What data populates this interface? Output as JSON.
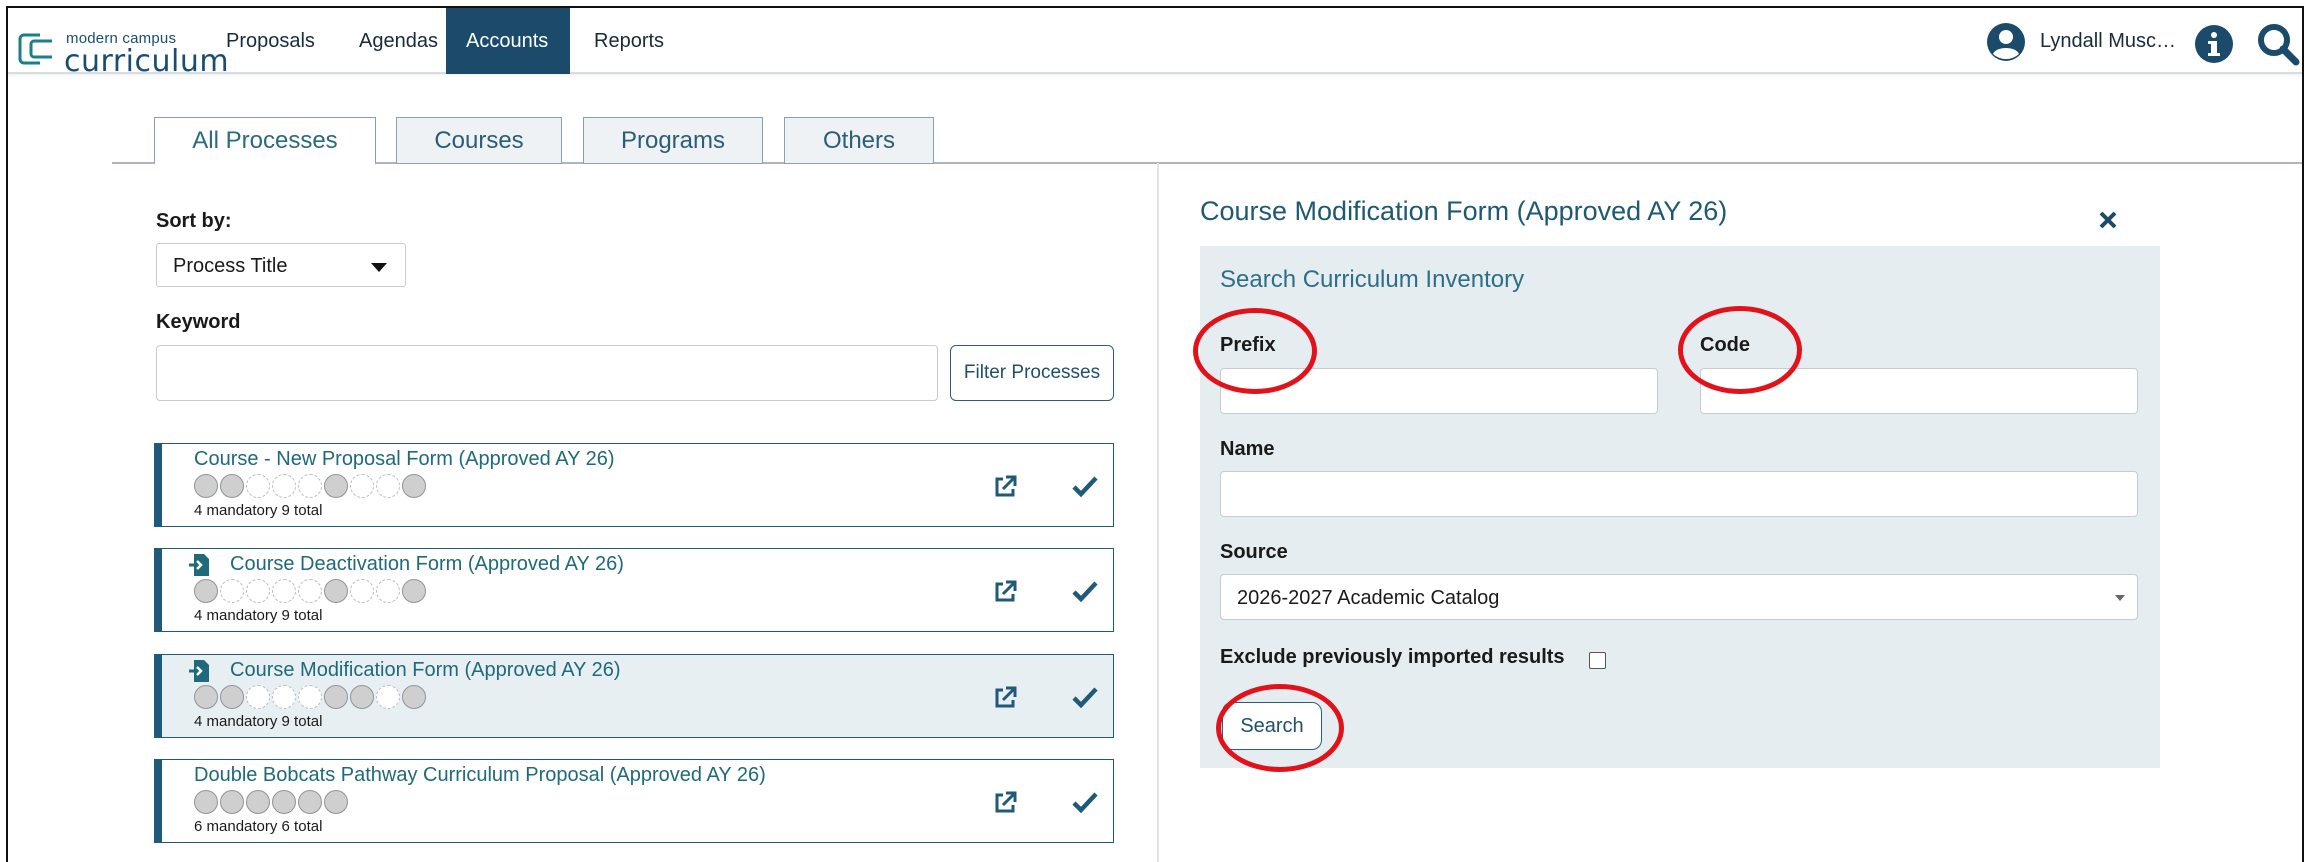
{
  "app": {
    "logo_small": "modern campus",
    "logo_big": "curriculum"
  },
  "nav": {
    "items": [
      {
        "label": "Proposals",
        "active": false
      },
      {
        "label": "Agendas",
        "active": false
      },
      {
        "label": "Accounts",
        "active": true
      },
      {
        "label": "Reports",
        "active": false
      }
    ],
    "user_name": "Lyndall Musc…"
  },
  "tabs": [
    {
      "label": "All Processes",
      "active": true
    },
    {
      "label": "Courses",
      "active": false
    },
    {
      "label": "Programs",
      "active": false
    },
    {
      "label": "Others",
      "active": false
    }
  ],
  "filters": {
    "sort_label": "Sort by:",
    "sort_value": "Process Title",
    "keyword_label": "Keyword",
    "keyword_value": "",
    "filter_button": "Filter Processes"
  },
  "processes": [
    {
      "title": "Course - New Proposal Form (Approved AY 26)",
      "has_doc_icon": false,
      "steps": [
        "f",
        "f",
        "e",
        "e",
        "e",
        "f",
        "e",
        "e",
        "f"
      ],
      "count": "4 mandatory 9 total",
      "selected": false
    },
    {
      "title": "Course Deactivation Form (Approved AY 26)",
      "has_doc_icon": true,
      "steps": [
        "f",
        "e",
        "e",
        "e",
        "e",
        "f",
        "e",
        "e",
        "f"
      ],
      "count": "4 mandatory 9 total",
      "selected": false
    },
    {
      "title": "Course Modification Form (Approved AY 26)",
      "has_doc_icon": true,
      "steps": [
        "f",
        "f",
        "e",
        "e",
        "e",
        "f",
        "f",
        "e",
        "f"
      ],
      "count": "4 mandatory 9 total",
      "selected": true
    },
    {
      "title": "Double Bobcats Pathway Curriculum Proposal (Approved AY 26)",
      "has_doc_icon": false,
      "steps": [
        "f",
        "f",
        "f",
        "f",
        "f",
        "f"
      ],
      "count": "6 mandatory 6 total",
      "selected": false
    }
  ],
  "detail": {
    "title": "Course Modification Form (Approved AY 26)",
    "search_title": "Search Curriculum Inventory",
    "prefix_label": "Prefix",
    "prefix_value": "",
    "code_label": "Code",
    "code_value": "",
    "name_label": "Name",
    "name_value": "",
    "source_label": "Source",
    "source_value": "2026-2027 Academic Catalog",
    "exclude_label": "Exclude previously imported results",
    "exclude_checked": false,
    "search_button": "Search"
  },
  "colors": {
    "brand": "#1b4a6b",
    "link": "#1f6a7a",
    "panel_bg": "#e5edf0",
    "highlight_ring": "#e2121b"
  },
  "icons": [
    "curriculum-logo-icon",
    "user-avatar-icon",
    "info-icon",
    "search-icon",
    "document-import-icon",
    "external-link-icon",
    "checkmark-icon",
    "close-icon"
  ]
}
